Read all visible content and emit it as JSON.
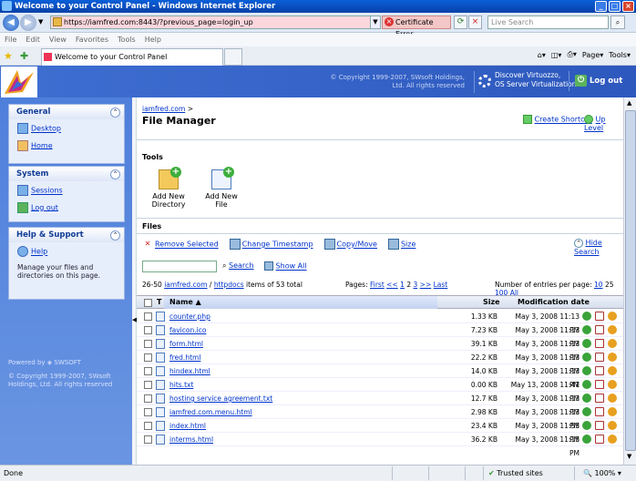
{
  "window": {
    "title": "Welcome to your Control Panel - Windows Internet Explorer"
  },
  "browser": {
    "url": "https://iamfred.com:8443/?previous_page=login_up",
    "cert_error": "Certificate Error",
    "search_placeholder": "Live Search",
    "menu": [
      "File",
      "Edit",
      "View",
      "Favorites",
      "Tools",
      "Help"
    ],
    "tab_title": "Welcome to your Control Panel",
    "page_menu": "Page",
    "tools_menu": "Tools"
  },
  "header": {
    "copyright": "© Copyright 1999-2007, SWsoft Holdings, Ltd. All rights reserved",
    "virtuozzo_line1": "Discover Virtuozzo,",
    "virtuozzo_line2": "OS Server Virtualization",
    "logout": "Log out"
  },
  "sidebar": {
    "general": {
      "title": "General",
      "items": [
        "Desktop",
        "Home"
      ]
    },
    "system": {
      "title": "System",
      "items": [
        "Sessions",
        "Log out"
      ]
    },
    "help": {
      "title": "Help & Support",
      "items": [
        "Help"
      ],
      "text": "Manage your files and directories on this page."
    },
    "powered": "Powered by ◈ SWSOFT",
    "copyright": "© Copyright 1999-2007, SWsoft Holdings, Ltd. All rights reserved"
  },
  "main": {
    "breadcrumb_link": "iamfred.com",
    "breadcrumb_sep": " >",
    "title": "File Manager",
    "create_shortcut": "Create Shortcut",
    "up_level": "Up Level",
    "tools_label": "Tools",
    "add_dir": "Add New Directory",
    "add_file": "Add New File",
    "files_label": "Files",
    "actions": [
      "Remove Selected",
      "Change Timestamp",
      "Copy/Move",
      "Size"
    ],
    "hide_search": "Hide Search",
    "search_btn": "Search",
    "show_all": "Show All",
    "range": "26-50",
    "path_1": "iamfred.com",
    "path_sep": "/",
    "path_2": "httpdocs",
    "items_text": "items of 53 total",
    "pages_label": "Pages:",
    "pages_first": "First",
    "pages_prev": "<<",
    "pages_1": "1",
    "pages_2": "2",
    "pages_3": "3",
    "pages_next": ">>",
    "pages_last": "Last",
    "per_page_label": "Number of entries per page:",
    "pp_10": "10",
    "pp_25": "25",
    "pp_100": "100",
    "pp_all": "All",
    "col_t": "T",
    "col_name": "Name ▲",
    "col_size": "Size",
    "col_date": "Modification date",
    "rows": [
      {
        "name": "counter.php",
        "size": "1.33 KB",
        "date": "May 3, 2008 11:13 PM"
      },
      {
        "name": "favicon.ico",
        "size": "7.23 KB",
        "date": "May 3, 2008 11:13 PM"
      },
      {
        "name": "form.html",
        "size": "39.1 KB",
        "date": "May 3, 2008 11:13 PM"
      },
      {
        "name": "fred.html",
        "size": "22.2 KB",
        "date": "May 3, 2008 11:13 PM"
      },
      {
        "name": "hindex.html",
        "size": "14.0 KB",
        "date": "May 3, 2008 11:13 PM"
      },
      {
        "name": "hits.txt",
        "size": "0.00 KB",
        "date": "May 13, 2008 11:41 PM"
      },
      {
        "name": "hosting service agreement.txt",
        "size": "12.7 KB",
        "date": "May 3, 2008 11:13 PM"
      },
      {
        "name": "iamfred.com.menu.html",
        "size": "2.98 KB",
        "date": "May 3, 2008 11:13 PM"
      },
      {
        "name": "index.html",
        "size": "23.4 KB",
        "date": "May 3, 2008 11:55 PM"
      },
      {
        "name": "interms.html",
        "size": "36.2 KB",
        "date": "May 3, 2008 11:15 PM"
      }
    ]
  },
  "status": {
    "left": "Done",
    "trusted": "Trusted sites",
    "zoom": "100%"
  }
}
